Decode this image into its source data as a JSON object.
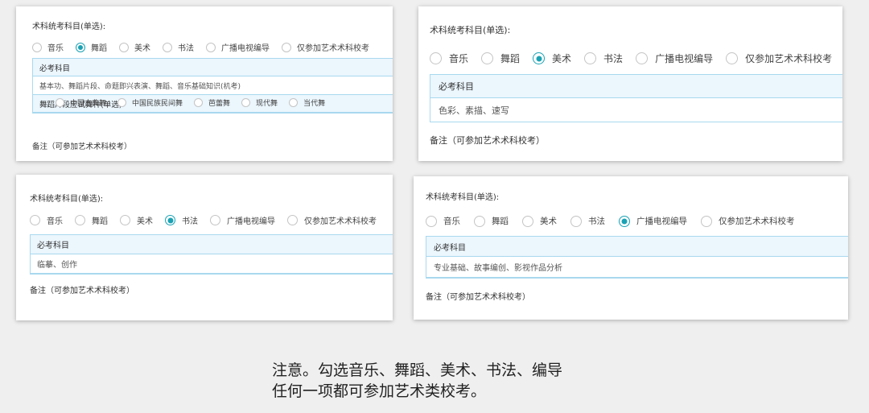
{
  "cards": {
    "c1": {
      "title": "术科统考科目(单选):",
      "options": [
        "音乐",
        "舞蹈",
        "美术",
        "书法",
        "广播电视编导",
        "仅参加艺术术科校考"
      ],
      "selected_index": 1,
      "panel_head": "必考科目",
      "panel_body": "基本功、舞蹈片段、命题即兴表演、舞蹈、音乐基础知识(机考)",
      "sub_head": "舞蹈片段应试舞种(单选)",
      "sub_options": [
        "中国古典舞",
        "中国民族民间舞",
        "芭蕾舞",
        "现代舞",
        "当代舞"
      ],
      "note": "备注（可参加艺术术科校考）"
    },
    "c2": {
      "title": "术科统考科目(单选):",
      "options": [
        "音乐",
        "舞蹈",
        "美术",
        "书法",
        "广播电视编导",
        "仅参加艺术术科校考"
      ],
      "selected_index": 2,
      "panel_head": "必考科目",
      "panel_body": "色彩、素描、速写",
      "note": "备注（可参加艺术术科校考）"
    },
    "c3": {
      "title": "术科统考科目(单选):",
      "options": [
        "音乐",
        "舞蹈",
        "美术",
        "书法",
        "广播电视编导",
        "仅参加艺术术科校考"
      ],
      "selected_index": 3,
      "panel_head": "必考科目",
      "panel_body": "临摹、创作",
      "note": "备注（可参加艺术术科校考）"
    },
    "c4": {
      "title": "术科统考科目(单选):",
      "options": [
        "音乐",
        "舞蹈",
        "美术",
        "书法",
        "广播电视编导",
        "仅参加艺术术科校考"
      ],
      "selected_index": 4,
      "panel_head": "必考科目",
      "panel_body": "专业基础、故事编创、影视作品分析",
      "note": "备注（可参加艺术术科校考）"
    }
  },
  "caption": {
    "line1": "注意。勾选音乐、舞蹈、美术、书法、编导",
    "line2": "任何一项都可参加艺术类校考。"
  },
  "colors": {
    "accent": "#1aa2b4",
    "panel_border": "#a9d9ef",
    "panel_head_bg": "#ebf6fd"
  }
}
